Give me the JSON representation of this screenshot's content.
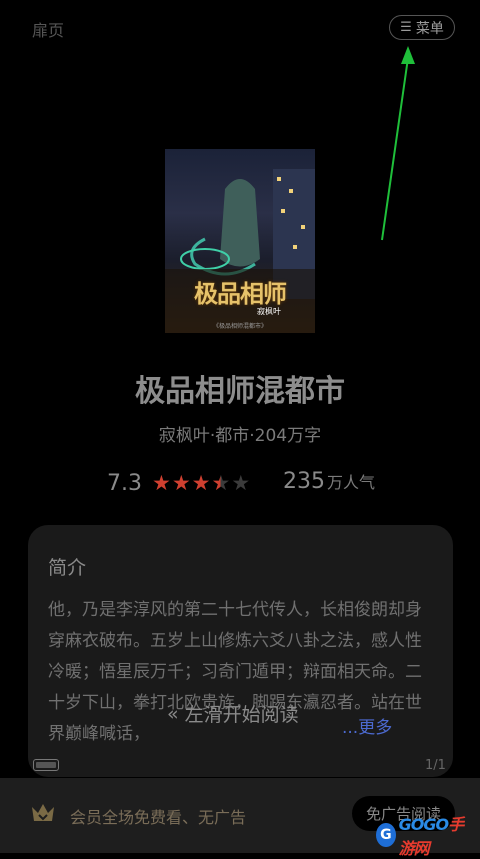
{
  "header": {
    "fly_page_label": "扉页",
    "menu_label": "菜单",
    "menu_icon": "hamburger-icon"
  },
  "cover": {
    "title": "极品相师",
    "author": "寂枫叶",
    "fine_print": "《极品相师混都市》"
  },
  "book": {
    "title": "极品相师混都市",
    "meta": "寂枫叶·都市·204万字",
    "score": "7.3",
    "stars": 3.5,
    "star_color": "#d04030",
    "popularity_number": "235",
    "popularity_unit": "万人气"
  },
  "intro": {
    "heading": "简介",
    "text": "他，乃是李淳风的第二十七代传人，长相俊朗却身穿麻衣破布。五岁上山修炼六爻八卦之法，感人性冷暖；悟星辰万千；习奇门遁甲；辩面相天命。二十岁下山，拳打北欧贵族，脚踢东瀛忍者。站在世界巅峰喊话，",
    "more_label": "...更多",
    "swipe_hint": "左滑开始阅读",
    "page_indicator": "1/1"
  },
  "vip": {
    "text": "会员全场免费看、无广告",
    "button_label": "免广告阅读"
  },
  "watermark": {
    "letter": "G",
    "text_latin": "GOGO",
    "text_cn": "手游网"
  },
  "colors": {
    "annotation_arrow": "#1fbf3a",
    "more_link": "#4c6ad0"
  }
}
